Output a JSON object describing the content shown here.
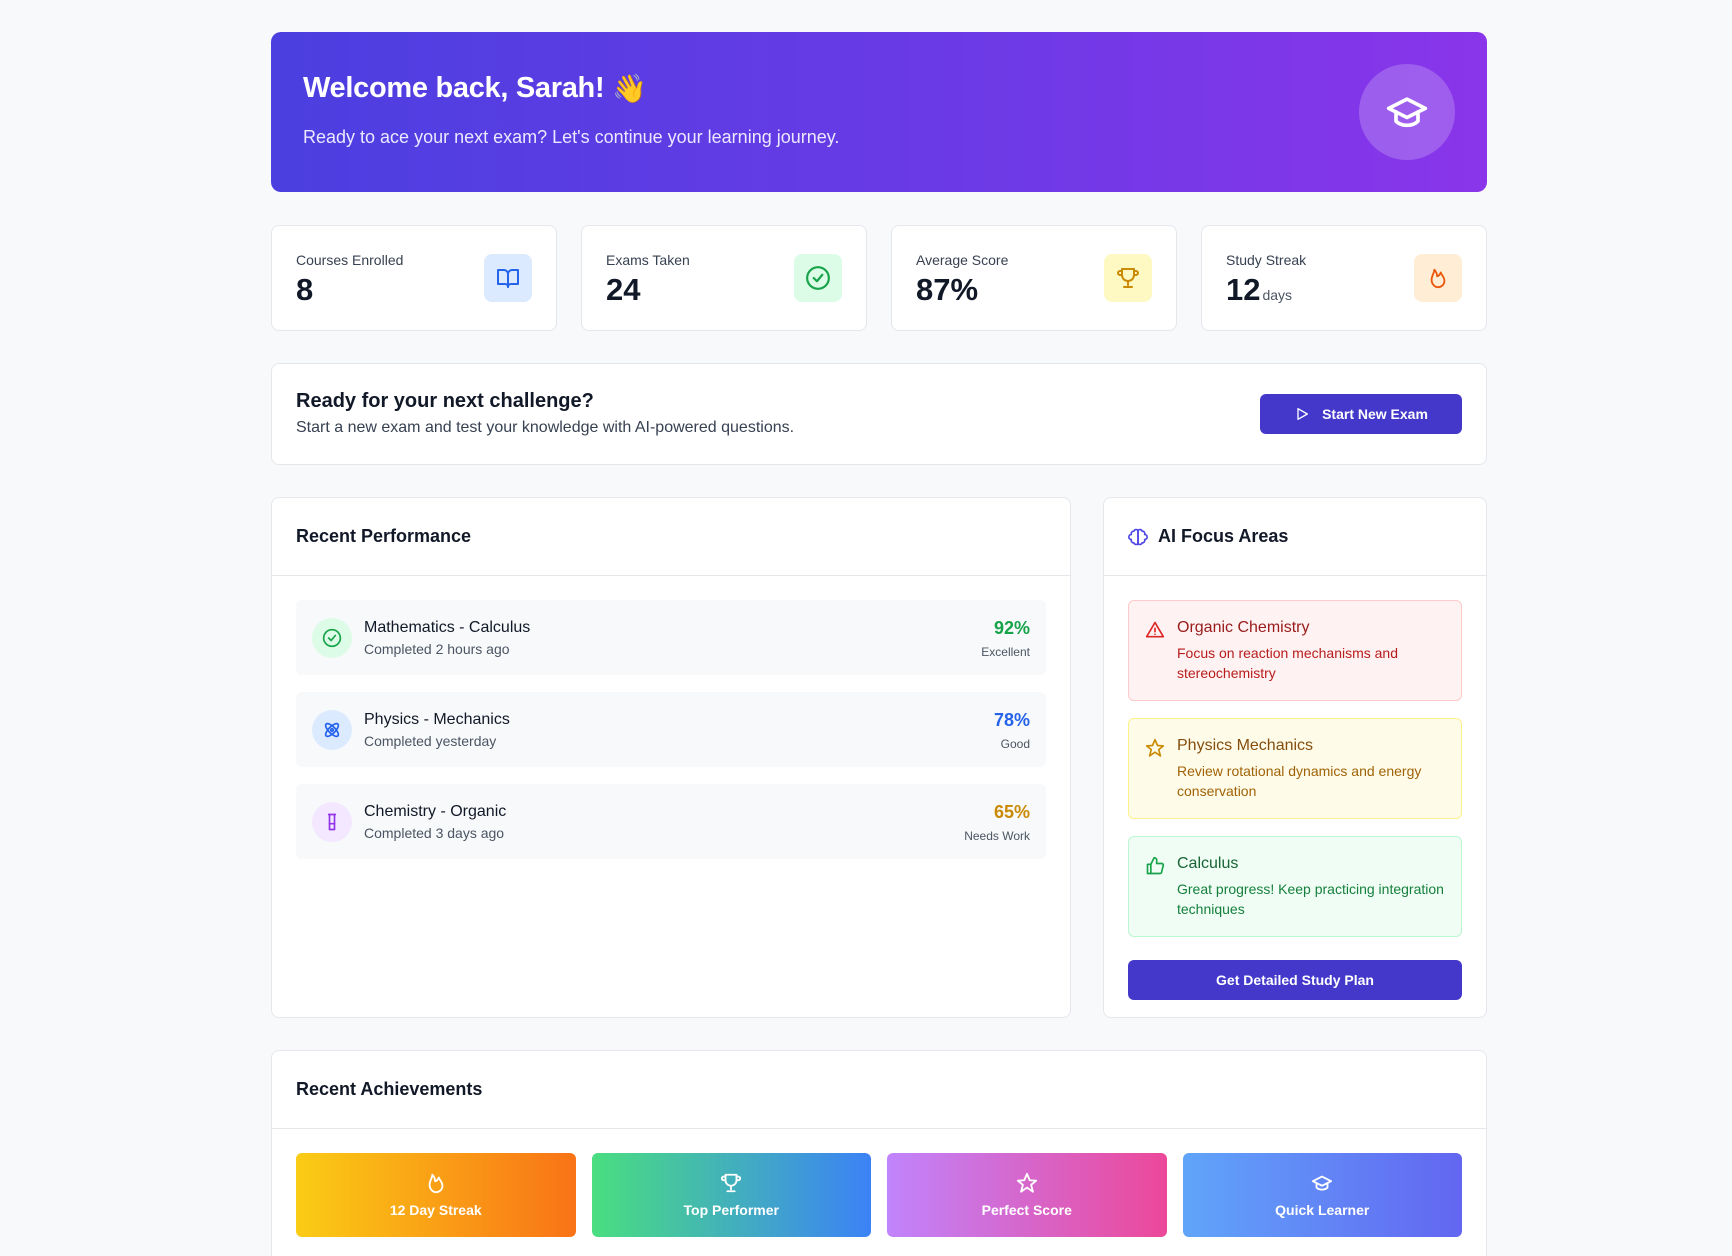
{
  "hero": {
    "title": "Welcome back, Sarah!",
    "emoji": "👋",
    "subtitle": "Ready to ace your next exam? Let's continue your learning journey.",
    "icon": "graduation-cap-icon"
  },
  "stats": [
    {
      "label": "Courses Enrolled",
      "value": "8",
      "unit": "",
      "icon": "book-icon",
      "color": "#2563eb",
      "bg": "#dbeafe"
    },
    {
      "label": "Exams Taken",
      "value": "24",
      "unit": "",
      "icon": "check-circle-icon",
      "color": "#16a34a",
      "bg": "#dcfce7"
    },
    {
      "label": "Average Score",
      "value": "87%",
      "unit": "",
      "icon": "trophy-icon",
      "color": "#ca8a04",
      "bg": "#fef9c3"
    },
    {
      "label": "Study Streak",
      "value": "12",
      "unit": "days",
      "icon": "flame-icon",
      "color": "#ea580c",
      "bg": "#ffedd5"
    }
  ],
  "challenge": {
    "title": "Ready for your next challenge?",
    "subtitle": "Start a new exam and test your knowledge with AI-powered questions.",
    "button": "Start New Exam"
  },
  "performance": {
    "title": "Recent Performance",
    "items": [
      {
        "title": "Mathematics - Calculus",
        "sub": "Completed 2 hours ago",
        "pct": "92%",
        "grade": "Excellent",
        "color": "#16a34a",
        "bg": "#dcfce7",
        "icon": "check-circle-icon"
      },
      {
        "title": "Physics - Mechanics",
        "sub": "Completed yesterday",
        "pct": "78%",
        "grade": "Good",
        "color": "#2563eb",
        "bg": "#dbeafe",
        "icon": "atom-icon"
      },
      {
        "title": "Chemistry - Organic",
        "sub": "Completed 3 days ago",
        "pct": "65%",
        "grade": "Needs Work",
        "color": "#ca8a04",
        "bg": "#f3e8ff",
        "icon": "flask-icon"
      }
    ]
  },
  "focus": {
    "title": "AI Focus Areas",
    "items": [
      {
        "title": "Organic Chemistry",
        "desc": "Focus on reaction mechanisms and stereochemistry",
        "icon": "warning-icon",
        "bg": "#fef2f2",
        "border": "#fecaca",
        "title_color": "#991b1b",
        "desc_color": "#b91c1c",
        "icon_color": "#dc2626"
      },
      {
        "title": "Physics Mechanics",
        "desc": "Review rotational dynamics and energy conservation",
        "icon": "star-icon",
        "bg": "#fefce8",
        "border": "#fef08a",
        "title_color": "#854d0e",
        "desc_color": "#a16207",
        "icon_color": "#ca8a04"
      },
      {
        "title": "Calculus",
        "desc": "Great progress! Keep practicing integration techniques",
        "icon": "thumbs-up-icon",
        "bg": "#f0fdf4",
        "border": "#bbf7d0",
        "title_color": "#166534",
        "desc_color": "#15803d",
        "icon_color": "#16a34a"
      }
    ],
    "button": "Get Detailed Study Plan"
  },
  "achievements": {
    "title": "Recent Achievements",
    "items": [
      {
        "label": "12 Day Streak",
        "icon": "flame-icon"
      },
      {
        "label": "Top Performer",
        "icon": "trophy-icon"
      },
      {
        "label": "Perfect Score",
        "icon": "star-icon"
      },
      {
        "label": "Quick Learner",
        "icon": "graduation-cap-icon"
      }
    ]
  }
}
